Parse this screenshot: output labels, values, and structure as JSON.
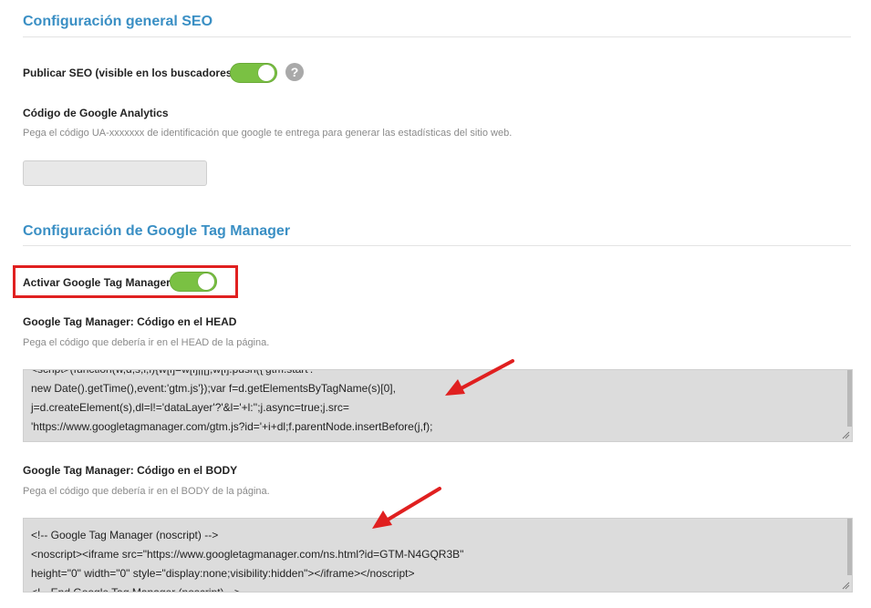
{
  "seo": {
    "title": "Configuración general SEO",
    "publish_label": "Publicar SEO (visible en los buscadores)",
    "help_icon": "?",
    "analytics_label": "Código de Google Analytics",
    "analytics_help": "Pega el código UA-xxxxxxx de identificación que google te entrega para generar las estadísticas del sitio web.",
    "analytics_value": ""
  },
  "gtm": {
    "title": "Configuración de Google Tag Manager",
    "activate_label": "Activar Google Tag Manager",
    "head_label": "Google Tag Manager: Código en el HEAD",
    "head_help": "Pega el código que debería ir en el HEAD de la página.",
    "head_lines": [
      "<script>(function(w,d,s,l,i){w[l]=w[l]||[];w[l].push({'gtm.start':",
      "new Date().getTime(),event:'gtm.js'});var f=d.getElementsByTagName(s)[0],",
      "j=d.createElement(s),dl=l!='dataLayer'?'&l='+l:'';j.async=true;j.src=",
      "'https://www.googletagmanager.com/gtm.js?id='+i+dl;f.parentNode.insertBefore(j,f);"
    ],
    "body_label": "Google Tag Manager: Código en el BODY",
    "body_help": "Pega el código que debería ir en el BODY de la página.",
    "body_lines": [
      "<!-- Google Tag Manager (noscript) -->",
      "<noscript><iframe src=\"https://www.googletagmanager.com/ns.html?id=GTM-N4GQR3B\"",
      "height=\"0\" width=\"0\" style=\"display:none;visibility:hidden\"></iframe></noscript>",
      "<!-- End Google Tag Manager (noscript) -->"
    ]
  },
  "colors": {
    "accent": "#3a8fc4",
    "toggle_on": "#7ac143",
    "annotation_red": "#e02020"
  },
  "icons": {
    "help": "question-mark-icon",
    "arrow": "red-arrow-icon",
    "resize": "resize-grip-icon"
  }
}
